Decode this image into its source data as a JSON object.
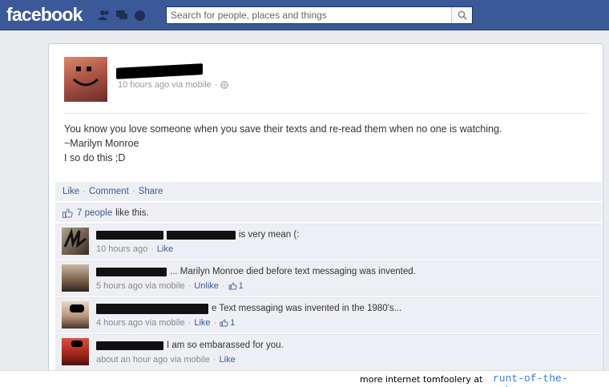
{
  "header": {
    "logo": "facebook",
    "search_placeholder": "Search for people, places and things"
  },
  "post": {
    "meta": "10 hours ago via mobile",
    "meta_sep": "·",
    "text_line1": "You know you love someone when you save their texts and re-read them when no one is watching.",
    "text_line2": "~Marilyn Monroe",
    "text_line3": "I so do this ;D",
    "actions": {
      "like": "Like",
      "comment": "Comment",
      "share": "Share",
      "sep": "·"
    },
    "likes": {
      "count_link": "7 people",
      "suffix": "like this."
    }
  },
  "comments": [
    {
      "text": "is very mean (:",
      "time": "10 hours ago",
      "action": "Like",
      "count": ""
    },
    {
      "text": "... Marilyn Monroe died before text messaging was invented.",
      "time": "5 hours ago via mobile",
      "action": "Unlike",
      "count": "1"
    },
    {
      "text": "e Text messaging was invented in the 1980's...",
      "time": "4 hours ago via mobile",
      "action": "Like",
      "count": "1"
    },
    {
      "text": "I am so embarassed for you.",
      "time": "about an hour ago via mobile",
      "action": "Like",
      "count": ""
    }
  ],
  "footer": {
    "text": "more internet tomfoolery at",
    "link": "runt-of-the-web.com"
  },
  "colors": {
    "brand": "#3b5998",
    "link": "#3b5998",
    "footer_link": "#3a7ee0"
  }
}
